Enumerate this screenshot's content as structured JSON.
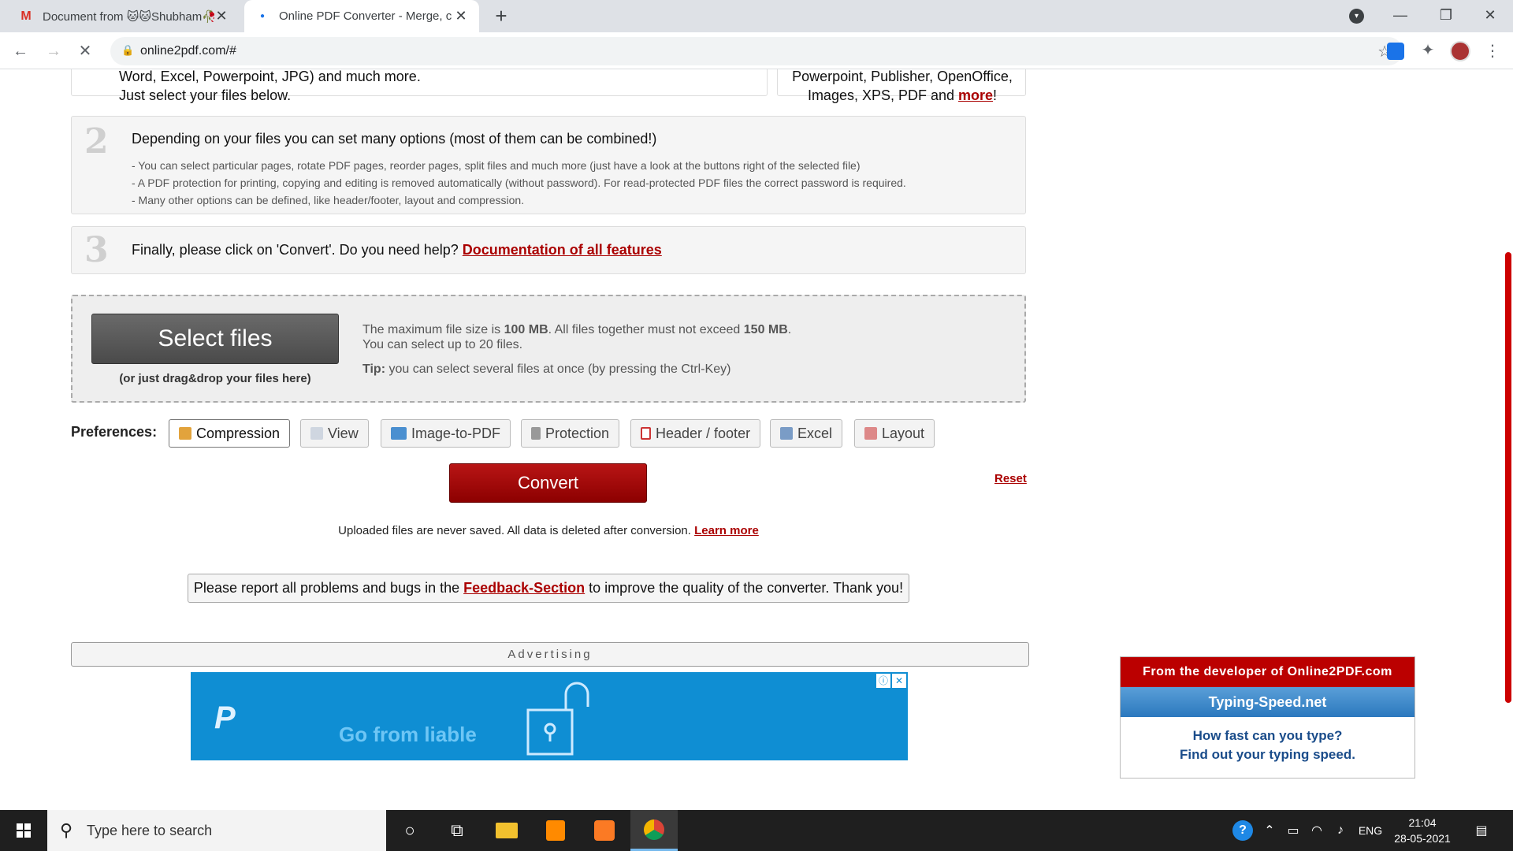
{
  "browser": {
    "tabs": [
      {
        "title": "Document from 🐱🐱Shubham🥀",
        "active": false
      },
      {
        "title": "Online PDF Converter - Merge, c",
        "active": true
      }
    ],
    "new_tab": "+",
    "url": "online2pdf.com/#"
  },
  "intro": {
    "left_line1": "Word, Excel, Powerpoint, JPG) and much more.",
    "left_line2": "Just select your files below.",
    "right_line1": "Powerpoint, Publisher, OpenOffice,",
    "right_line2_prefix": "Images, XPS, PDF and ",
    "right_line2_link": "more",
    "right_line2_suffix": "!"
  },
  "step2": {
    "number": "2",
    "title": "Depending on your files you can set many options (most of them can be combined!)",
    "bullets": [
      "- You can select particular pages, rotate PDF pages, reorder pages, split files and much more (just have a look at the buttons right of the selected file)",
      "- A PDF protection for printing, copying and editing is removed automatically (without password). For read-protected PDF files the correct password is required.",
      "- Many other options can be defined, like header/footer, layout and compression."
    ]
  },
  "step3": {
    "number": "3",
    "text": "Finally, please click on 'Convert'. Do you need help? ",
    "link": "Documentation of all features"
  },
  "upload": {
    "button": "Select files",
    "drag_hint": "(or just drag&drop your files here)",
    "max_prefix": "The maximum file size is ",
    "max_size": "100 MB",
    "max_mid": ". All files together must not exceed ",
    "total_size": "150 MB",
    "max_suffix": ".",
    "count_text": "You can select up to 20 files.",
    "tip_label": "Tip:",
    "tip_text": " you can select several files at once (by pressing the Ctrl-Key)"
  },
  "preferences": {
    "label": "Preferences:",
    "buttons": [
      "Compression",
      "View",
      "Image-to-PDF",
      "Protection",
      "Header / footer",
      "Excel",
      "Layout"
    ]
  },
  "actions": {
    "convert": "Convert",
    "reset": "Reset"
  },
  "privacy": {
    "text": "Uploaded files are never saved. All data is deleted after conversion. ",
    "link": "Learn more"
  },
  "feedback": {
    "prefix": "Please report all problems and bugs in the ",
    "link": "Feedback-Section",
    "suffix": " to improve the quality of the converter. Thank you!"
  },
  "advertising": {
    "label": "Advertising",
    "logo": "P",
    "slogan": "Go from liable",
    "controls": [
      "ⓘ",
      "✕"
    ]
  },
  "developer_box": {
    "header": "From the developer of Online2PDF.com",
    "title": "Typing-Speed.net",
    "line1": "How fast can you type?",
    "line2": "Find out your typing speed."
  },
  "taskbar": {
    "search_placeholder": "Type here to search",
    "language": "ENG",
    "time": "21:04",
    "date": "28-05-2021"
  },
  "colors": {
    "accent_red": "#a00",
    "chrome_tabstrip": "#dee1e6",
    "ad_blue": "#0f8ed3"
  }
}
